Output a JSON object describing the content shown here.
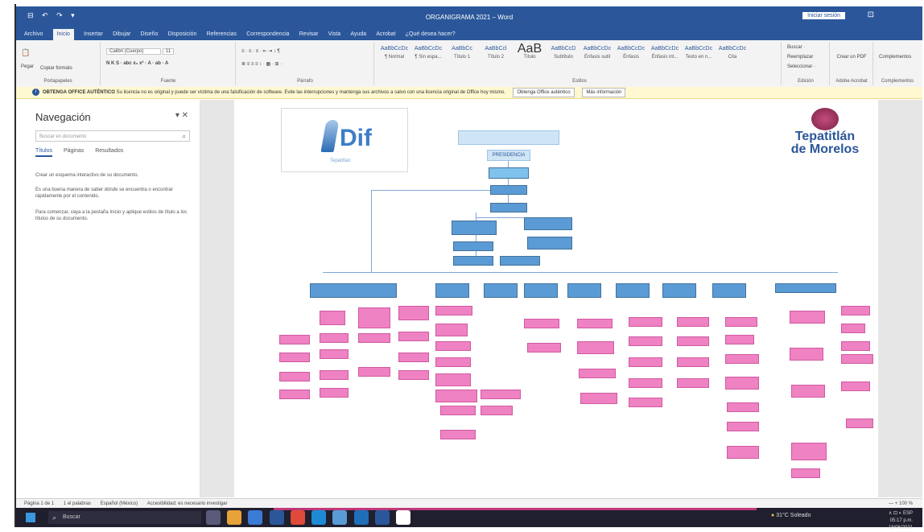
{
  "window": {
    "title": "ORGANIGRAMA 2021 – Word",
    "sign_in": "Iniciar sesión",
    "qat": "⊟ ↶ ↷ ▾"
  },
  "menu": {
    "tabs": [
      "Archivo",
      "Inicio",
      "Insertar",
      "Dibujar",
      "Diseño",
      "Disposición",
      "Referencias",
      "Correspondencia",
      "Revisar",
      "Vista",
      "Ayuda",
      "Acrobat",
      "¿Qué desea hacer?"
    ],
    "active": "Inicio"
  },
  "ribbon": {
    "clipboard": {
      "label": "Portapapeles",
      "paste": "Pegar",
      "copy_format": "Copiar formato"
    },
    "font": {
      "label": "Fuente",
      "family": "Calibri (Cuerpo)",
      "size": "11",
      "row2": "N  K  S  ·  abc  x₂  x²  ·  A  ·  ab  ·  A"
    },
    "paragraph": {
      "label": "Párrafo",
      "row1": "≡ · ≡ · ≡ ·  ⇤ ⇥  ↕  ¶",
      "row2": "≣  ≡  ≡  ≡  ↕ ·  ▦ ·  ⊞ ·"
    },
    "styles": {
      "label": "Estilos",
      "items": [
        {
          "sample": "AaBbCcDc",
          "name": "¶ Normal"
        },
        {
          "sample": "AaBbCcDc",
          "name": "¶ Sin espa..."
        },
        {
          "sample": "AaBbCc",
          "name": "Título 1"
        },
        {
          "sample": "AaBbCcl",
          "name": "Título 2"
        },
        {
          "sample": "AaB",
          "name": "Título",
          "big": true
        },
        {
          "sample": "AaBbCcD",
          "name": "Subtítulo"
        },
        {
          "sample": "AaBbCcDc",
          "name": "Énfasis sutil"
        },
        {
          "sample": "AaBbCcDc",
          "name": "Énfasis"
        },
        {
          "sample": "AaBbCcDc",
          "name": "Énfasis int..."
        },
        {
          "sample": "AaBbCcDc",
          "name": "Texto en n..."
        },
        {
          "sample": "AaBbCcDc",
          "name": "Cita"
        }
      ]
    },
    "editing": {
      "label": "Edición",
      "find": "Buscar ·",
      "replace": "Reemplazar",
      "select": "Seleccionar ·"
    },
    "pdf": {
      "label": "Adobe Acrobat",
      "create": "Crear un PDF"
    },
    "addins": {
      "label": "Complementos",
      "name": "Complementos"
    }
  },
  "infobar": {
    "title": "OBTENGA OFFICE AUTÉNTICO",
    "message": "Su licencia no es original y puede ser víctima de una falsificación de software. Evite las interrupciones y mantenga sus archivos a salvo con una licencia original de Office hoy mismo.",
    "button": "Obtenga Office auténtico",
    "more": "Más información"
  },
  "navigation": {
    "title": "Navegación",
    "search_placeholder": "Buscar en documento",
    "tabs": [
      "Títulos",
      "Páginas",
      "Resultados"
    ],
    "p1": "Crear un esquema interactivo de su documento.",
    "p2": "Es una buena manera de saber dónde se encuentra o encontrar rápidamente por el contenido.",
    "p3": "Para comenzar, vaya a la pestaña Inicio y aplique estilos de título a los títulos de su documento."
  },
  "document": {
    "logo_left_text": "Dif",
    "logo_left_sub": "Tepatitlán",
    "logo_right_line1": "Tepatitlán",
    "logo_right_line2": "de Morelos",
    "org_top_label": "PRESIDENCIA"
  },
  "status": {
    "page": "Página 1 de 1",
    "words": "1 el palabras",
    "language": "Español (México)",
    "accessibility": "Accesibilidad: es necesario investigar",
    "zoom": "— + 100 %"
  },
  "taskbar": {
    "search": "Buscar",
    "weather": "31°C  Soleado",
    "tray": "∧  ⊡  ◐  ESP",
    "time": "05:17 p.m.",
    "date": "18/06/2021"
  },
  "colors": {
    "word_blue": "#2b579a",
    "org_blue": "#5b9bd5",
    "org_pink": "#ee82c2"
  }
}
